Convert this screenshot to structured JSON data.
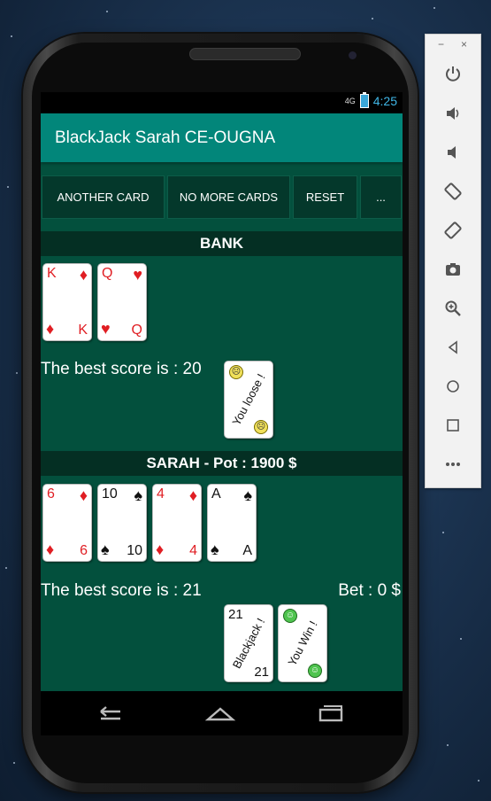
{
  "app": {
    "title": "BlackJack Sarah CE-OUGNA"
  },
  "statusbar": {
    "signal": "4G",
    "time": "4:25"
  },
  "toolbar": {
    "another_card": "ANOTHER CARD",
    "no_more_cards": "NO MORE CARDS",
    "reset": "RESET",
    "more": "..."
  },
  "bank": {
    "header": "BANK",
    "cards": [
      {
        "rank": "K",
        "suit": "♦",
        "color": "red"
      },
      {
        "rank": "Q",
        "suit": "♥",
        "color": "red"
      }
    ],
    "score_text": "The best score is : 20",
    "result_text": "You loose !"
  },
  "player": {
    "header": "SARAH - Pot : 1900 $",
    "cards": [
      {
        "rank": "6",
        "suit": "♦",
        "color": "red"
      },
      {
        "rank": "10",
        "suit": "♠",
        "color": "black"
      },
      {
        "rank": "4",
        "suit": "♦",
        "color": "red"
      },
      {
        "rank": "A",
        "suit": "♠",
        "color": "black"
      }
    ],
    "score_text": "The best score is : 21",
    "bet_text": "Bet : 0 $",
    "blackjack_card": {
      "value": "21",
      "text": "Blackjack !"
    },
    "result_text": "You Win !"
  },
  "emulator": {
    "minimize": "−",
    "close": "×",
    "buttons": [
      "power-icon",
      "volume-up-icon",
      "volume-down-icon",
      "rotate-left-icon",
      "rotate-right-icon",
      "camera-icon",
      "zoom-icon",
      "back-icon",
      "home-icon",
      "overview-icon",
      "more-icon"
    ]
  },
  "colors": {
    "app_bar": "#02867a",
    "table": "#03503d",
    "header_band": "#042f23",
    "button": "#04382b"
  }
}
